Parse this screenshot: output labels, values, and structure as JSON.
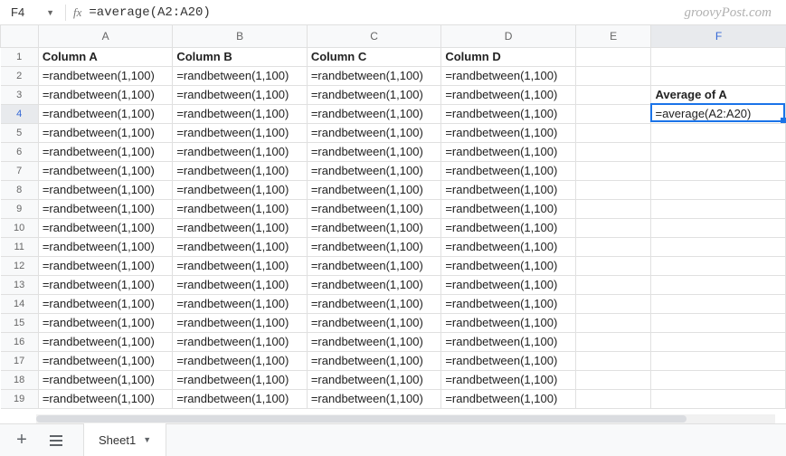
{
  "nameBox": {
    "value": "F4"
  },
  "fxLabel": "fx",
  "formulaBar": {
    "value": "=average(A2:A20)"
  },
  "watermark": "groovyPost.com",
  "columns": [
    "A",
    "B",
    "C",
    "D",
    "E",
    "F"
  ],
  "activeColumn": "F",
  "activeRow": 4,
  "activeCell": "F4",
  "headerRow": {
    "A": "Column A",
    "B": "Column B",
    "C": "Column C",
    "D": "Column D",
    "E": "",
    "F": ""
  },
  "formulaCell": "=randbetween(1,100)",
  "sideLabels": {
    "F3": "Average of A",
    "F4": "=average(A2:A20)"
  },
  "rowsVisible": 19,
  "sheetTab": {
    "name": "Sheet1"
  }
}
